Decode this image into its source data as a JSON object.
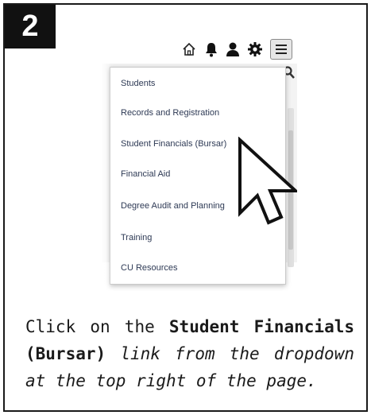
{
  "step_number": "2",
  "toolbar": {
    "icons": [
      "home-icon",
      "bell-icon",
      "user-icon",
      "gear-icon",
      "hamburger-menu-icon",
      "search-icon"
    ]
  },
  "menu": {
    "items": [
      {
        "label": "Students"
      },
      {
        "label": "Records and Registration"
      },
      {
        "label": "Student Financials (Bursar)"
      },
      {
        "label": "Financial Aid"
      },
      {
        "label": "Degree Audit and Planning"
      },
      {
        "label": "Training"
      },
      {
        "label": "CU Resources"
      }
    ]
  },
  "caption": {
    "prefix": "Click on the ",
    "bold": "Student Financials (Bursar)",
    "space": " ",
    "italic": "link from the dropdown at the top right of the page."
  },
  "colors": {
    "badge_bg": "#111111",
    "menu_text": "#2e3a55",
    "border": "#1a1a1a"
  }
}
